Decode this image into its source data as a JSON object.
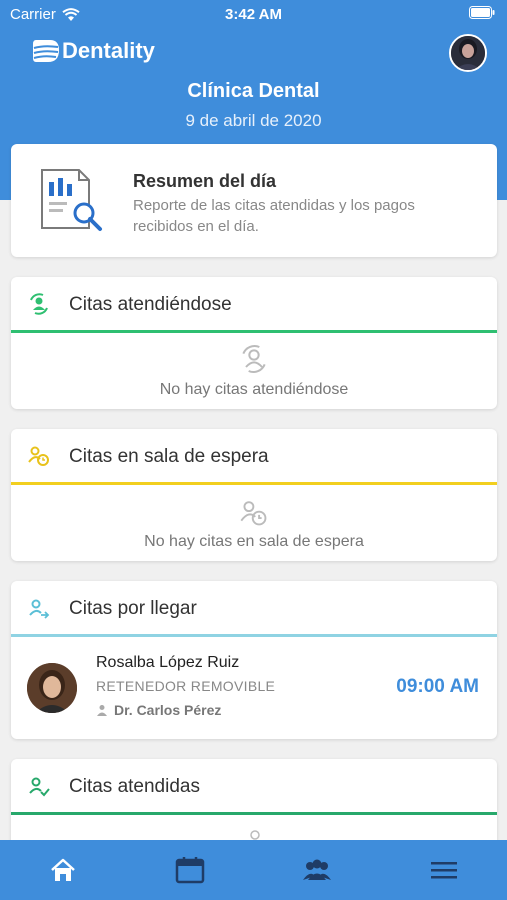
{
  "status_bar": {
    "carrier": "Carrier",
    "time": "3:42 AM"
  },
  "app": {
    "name": "Dentality"
  },
  "clinic": {
    "title": "Clínica Dental",
    "date": "9 de abril de 2020"
  },
  "summary": {
    "title": "Resumen del día",
    "description": "Reporte de las citas atendidas y los pagos recibidos en el día."
  },
  "sections": {
    "attending": {
      "title": "Citas atendiéndose",
      "empty_text": "No hay citas atendiéndose",
      "color": "#2fbf71"
    },
    "waiting": {
      "title": "Citas en sala de espera",
      "empty_text": "No hay citas en sala de espera",
      "color": "#f2cf1f"
    },
    "arriving": {
      "title": "Citas por llegar",
      "color": "#8fd3e3",
      "appointments": [
        {
          "patient": "Rosalba López Ruiz",
          "treatment": "RETENEDOR REMOVIBLE",
          "doctor": "Dr. Carlos Pérez",
          "time": "09:00 AM"
        }
      ]
    },
    "attended": {
      "title": "Citas atendidas",
      "color": "#27a86b"
    }
  },
  "nav": {
    "items": [
      "home-icon",
      "calendar-icon",
      "patients-icon",
      "menu-icon"
    ]
  },
  "colors": {
    "primary": "#3f8ddb"
  }
}
